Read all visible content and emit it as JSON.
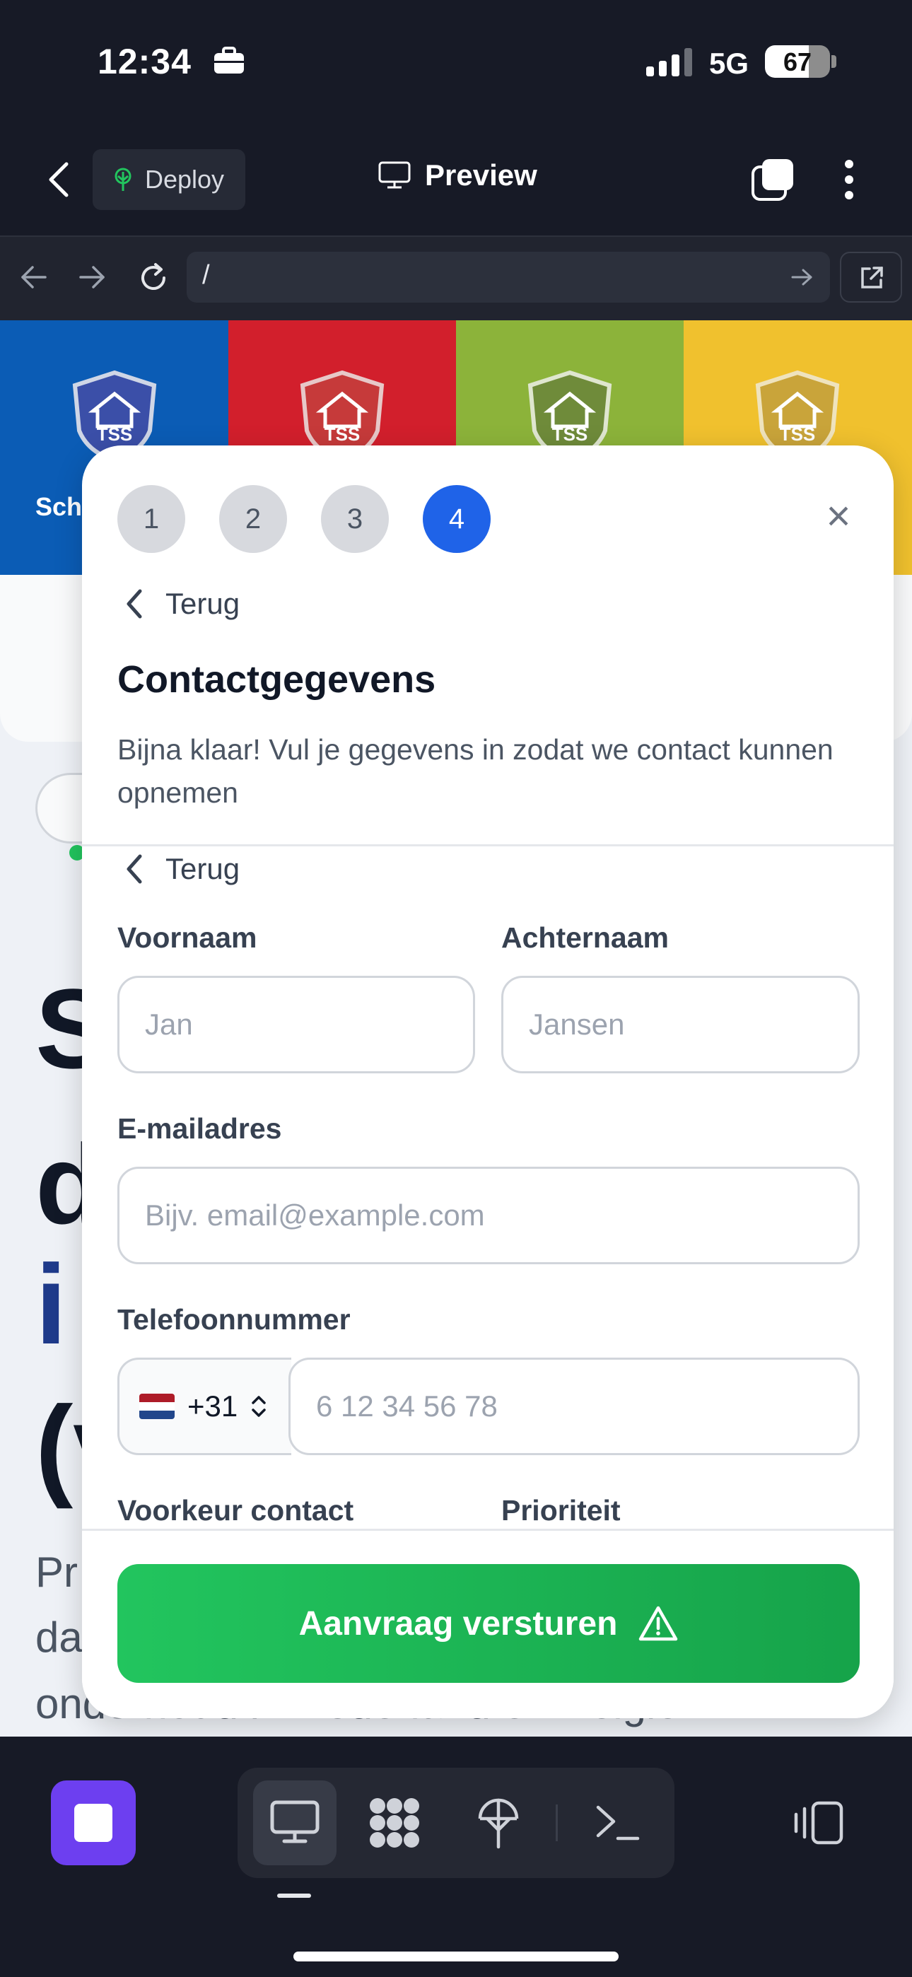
{
  "status_bar": {
    "time": "12:34",
    "network": "5G",
    "battery": "67",
    "battery_level": 0.67,
    "icons": [
      "briefcase-icon",
      "signal-icon"
    ]
  },
  "app_header": {
    "deploy_label": "Deploy",
    "preview_label": "Preview",
    "icons": [
      "back-chevron-icon",
      "deploy-tree-icon",
      "monitor-icon",
      "tabs-icon",
      "more-vertical-icon"
    ]
  },
  "url_bar": {
    "path": "/",
    "icons": [
      "arrow-left-icon",
      "arrow-right-icon",
      "reload-icon",
      "go-arrow-icon",
      "external-link-icon"
    ]
  },
  "site": {
    "band_label": "Sch",
    "band_colors": [
      "#0b5cb5",
      "#d21f2c",
      "#8cb33a",
      "#f0c12e"
    ],
    "logo_text": "TSS",
    "heading_fragments": [
      "S",
      "d",
      "i",
      "(v"
    ],
    "para_fragments": [
      "Pr",
      "da",
      "onderhoud in Nederland en België."
    ]
  },
  "modal": {
    "steps": [
      "1",
      "2",
      "3",
      "4"
    ],
    "active_step": 4,
    "back_label": "Terug",
    "title": "Contactgegevens",
    "subtitle": "Bijna klaar! Vul je gegevens in zodat we contact kunnen opnemen",
    "form": {
      "first_name_label": "Voornaam",
      "first_name_placeholder": "Jan",
      "last_name_label": "Achternaam",
      "last_name_placeholder": "Jansen",
      "email_label": "E-mailadres",
      "email_placeholder": "Bijv. email@example.com",
      "phone_label": "Telefoonnummer",
      "country_code": "+31",
      "phone_placeholder": "6 12 34 56 78",
      "contact_pref_label": "Voorkeur contact",
      "priority_label": "Prioriteit"
    },
    "submit_label": "Aanvraag versturen",
    "colors": {
      "active_step": "#1f63e8",
      "submit_start": "#22c55e",
      "submit_end": "#16a34a"
    }
  },
  "bottom_toolbar": {
    "icons": [
      "stop-icon",
      "desktop-icon",
      "apps-grid-icon",
      "deploy-icon",
      "terminal-icon",
      "device-switch-icon"
    ],
    "accent": "#6d3ff0"
  }
}
